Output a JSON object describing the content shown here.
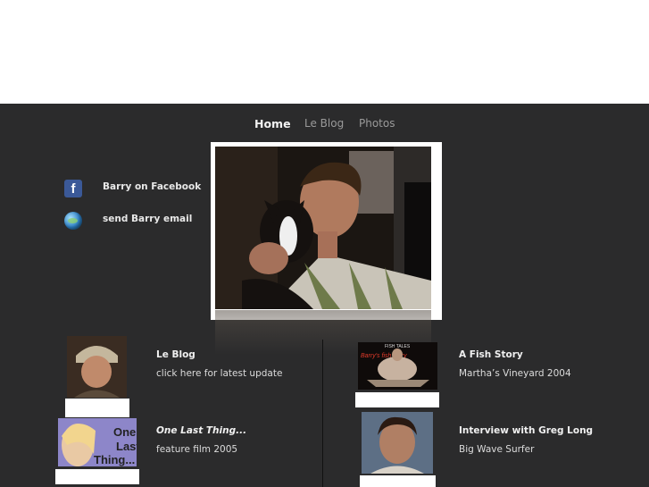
{
  "nav": {
    "home": "Home",
    "blog": "Le Blog",
    "photos": "Photos"
  },
  "social": {
    "facebook_label": "Barry on Facebook",
    "email_label": "send Barry email",
    "facebook_icon": "facebook-icon",
    "email_icon": "globe-mail-icon"
  },
  "hero": {
    "image_icon": "portrait-with-dog-photo"
  },
  "items": {
    "blog": {
      "title": "Le Blog",
      "subtitle": "click here for latest update"
    },
    "fish": {
      "title": "A Fish Story",
      "subtitle": "Martha’s Vineyard 2004",
      "thumb_text_top": "FISH TALES",
      "thumb_text": "Barry's fish story"
    },
    "film": {
      "title": "One Last Thing...",
      "subtitle": "feature film 2005",
      "thumb_text": "One Last Thing..."
    },
    "interview": {
      "title": "Interview with Greg Long",
      "subtitle": "Big Wave Surfer"
    }
  },
  "colors": {
    "background": "#2b2b2c",
    "nav_active": "#f2f2f2",
    "nav_inactive": "#9a9a9a",
    "facebook_blue": "#3b5998"
  }
}
